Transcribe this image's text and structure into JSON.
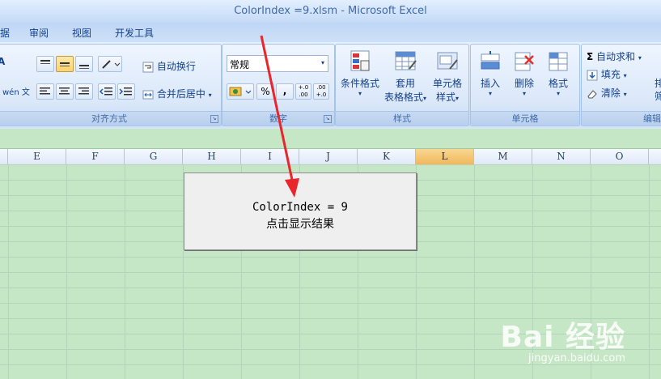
{
  "window": {
    "title": "ColorIndex =9.xlsm - Microsoft Excel"
  },
  "tabs": [
    "据",
    "审阅",
    "视图",
    "开发工具"
  ],
  "ribbon": {
    "alignment": {
      "wrap_text": "自动换行",
      "merge_center": "合并后居中",
      "group_label": "对齐方式",
      "font_fragment": "A",
      "phonetic": "wén 文"
    },
    "number": {
      "format_value": "常规",
      "percent": "%",
      "comma": ",",
      "inc_decimal": "+.0 .00",
      "dec_decimal": ".00 +.0",
      "group_label": "数字"
    },
    "styles": {
      "conditional_format": "条件格式",
      "table_format_line1": "套用",
      "table_format_line2": "表格格式",
      "cell_styles_line1": "单元格",
      "cell_styles_line2": "样式",
      "group_label": "样式"
    },
    "cells": {
      "insert": "插入",
      "delete": "删除",
      "format": "格式",
      "group_label": "单元格"
    },
    "editing": {
      "autosum": "自动求和",
      "fill": "填充",
      "clear": "清除",
      "sort_fragment_1": "排",
      "sort_fragment_2": "筛",
      "group_label": "编辑"
    }
  },
  "columns": [
    "E",
    "F",
    "G",
    "H",
    "I",
    "J",
    "K",
    "L",
    "M",
    "N",
    "O"
  ],
  "selected_column": "L",
  "macro_button": {
    "line1": "ColorIndex = 9",
    "line2": "点击显示结果"
  },
  "watermark": {
    "brand": "Bai 经验",
    "url": "jingyan.baidu.com"
  },
  "colors": {
    "sheet_bg": "#c6e7c6",
    "ribbon_blue": "#dbe8f9",
    "annotation_arrow": "#e8262b"
  }
}
